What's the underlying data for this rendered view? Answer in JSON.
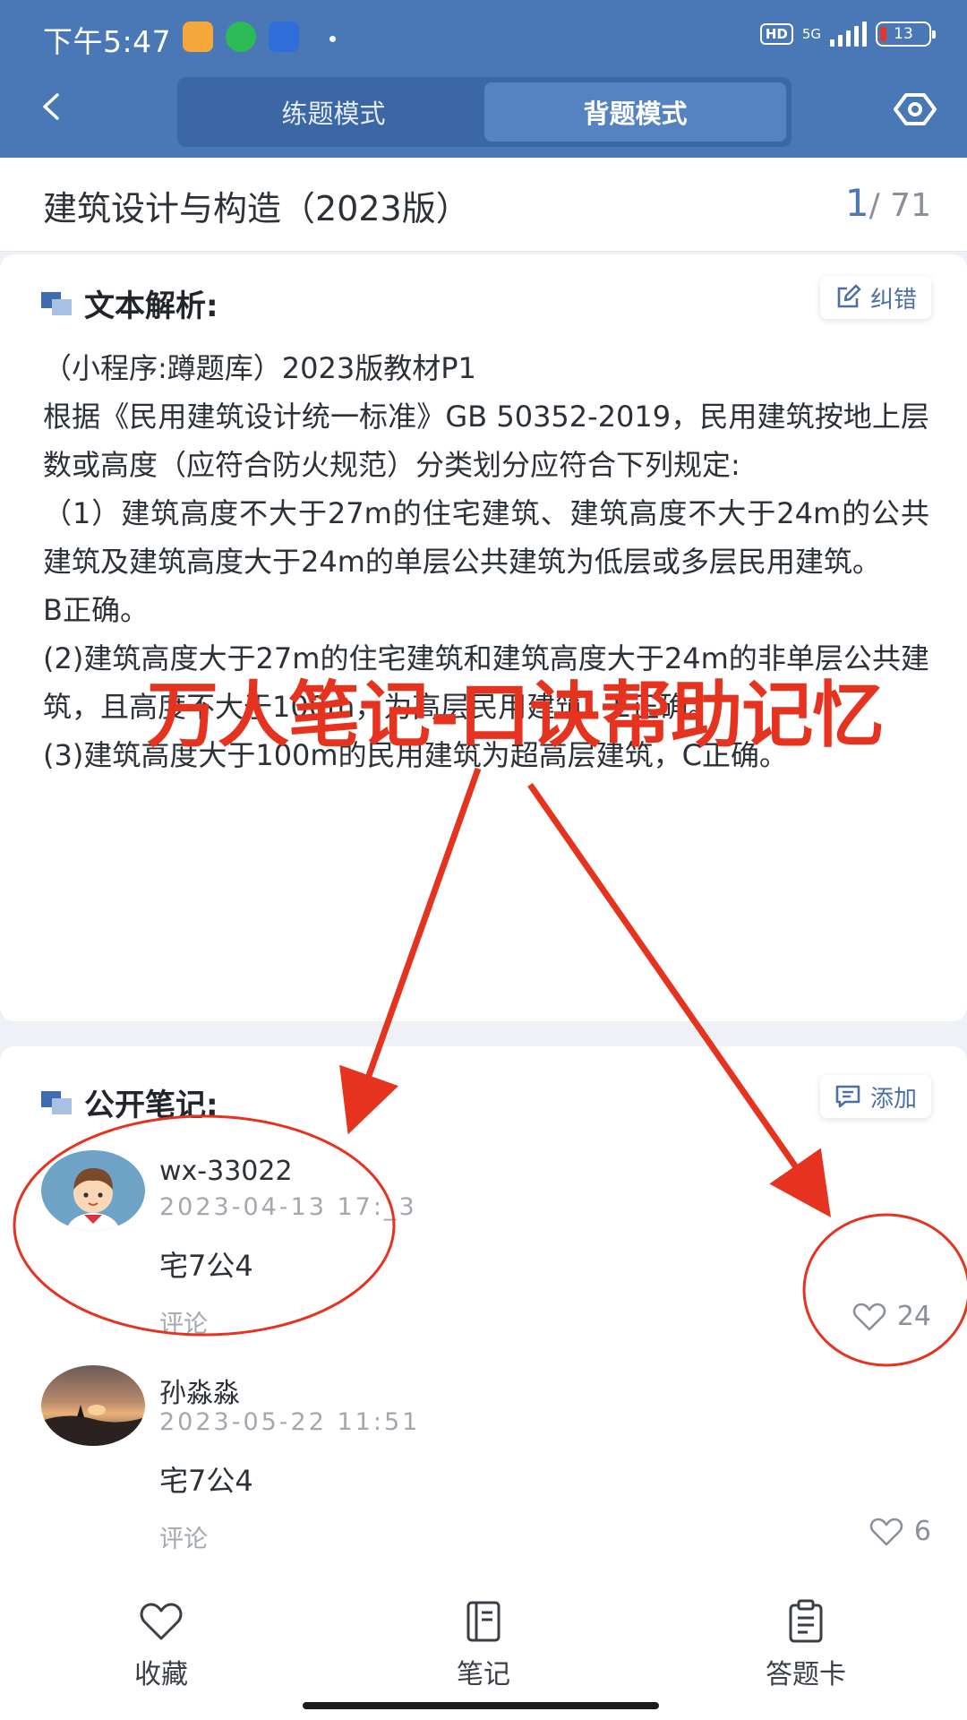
{
  "status_bar": {
    "time": "下午5:47",
    "hd": "HD",
    "network": "5G",
    "battery": "13"
  },
  "header": {
    "tabs": [
      {
        "label": "练题模式",
        "active": false
      },
      {
        "label": "背题模式",
        "active": true
      }
    ]
  },
  "title_bar": {
    "title": "建筑设计与构造（2023版）",
    "current": "1",
    "total": "/ 71"
  },
  "analysis": {
    "heading": "文本解析:",
    "correct_label": "纠错",
    "paragraphs": [
      "（小程序:蹲题库）2023版教材P1",
      "根据《民用建筑设计统一标准》GB 50352-2019，民用建筑按地上层数或高度（应符合防火规范）分类划分应符合下列规定:",
      "（1）建筑高度不大于27m的住宅建筑、建筑高度不大于24m的公共建筑及建筑高度大于24m的单层公共建筑为低层或多层民用建筑。",
      "B正确。",
      "(2)建筑高度大于27m的住宅建筑和建筑高度大于24m的非单层公共建筑，且高度不大于100m，为高层民用建筑。E正确。",
      "(3)建筑高度大于100m的民用建筑为超高层建筑，C正确。"
    ]
  },
  "notes": {
    "heading": "公开笔记:",
    "add_label": "添加",
    "items": [
      {
        "user": "wx-33022",
        "date": "2023-04-13 17:_3",
        "content": "宅7公4",
        "comment_label": "评论",
        "likes": "24"
      },
      {
        "user": "孙淼淼",
        "date": "2023-05-22 11:51",
        "content": "宅7公4",
        "comment_label": "评论",
        "likes": "6"
      }
    ]
  },
  "bottom_nav": [
    {
      "label": "收藏",
      "icon": "heart-icon"
    },
    {
      "label": "笔记",
      "icon": "notebook-icon"
    },
    {
      "label": "答题卡",
      "icon": "clipboard-icon"
    }
  ],
  "annotation": {
    "text": "万人笔记-口诀帮助记忆",
    "color": "#e5331f"
  },
  "colors": {
    "header_blue": "#4a78b6",
    "accent_blue": "#4d6fa3"
  }
}
